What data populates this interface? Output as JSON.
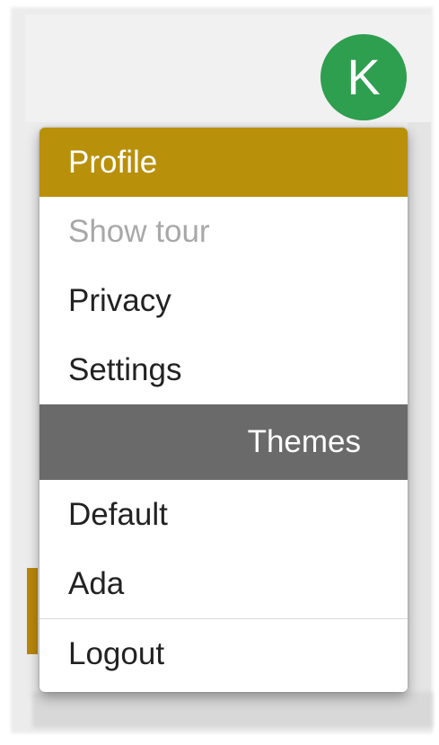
{
  "user": {
    "avatar_initial": "K",
    "avatar_color": "#2e9e4f"
  },
  "menu": {
    "accent_color": "#b8900a",
    "section_color": "#6a6a6a",
    "items": [
      {
        "label": "Profile",
        "state": "active"
      },
      {
        "label": "Show tour",
        "state": "disabled"
      },
      {
        "label": "Privacy",
        "state": "normal"
      },
      {
        "label": "Settings",
        "state": "normal"
      }
    ],
    "themes_header": "Themes",
    "themes": [
      {
        "label": "Default"
      },
      {
        "label": "Ada"
      }
    ],
    "logout_label": "Logout"
  }
}
